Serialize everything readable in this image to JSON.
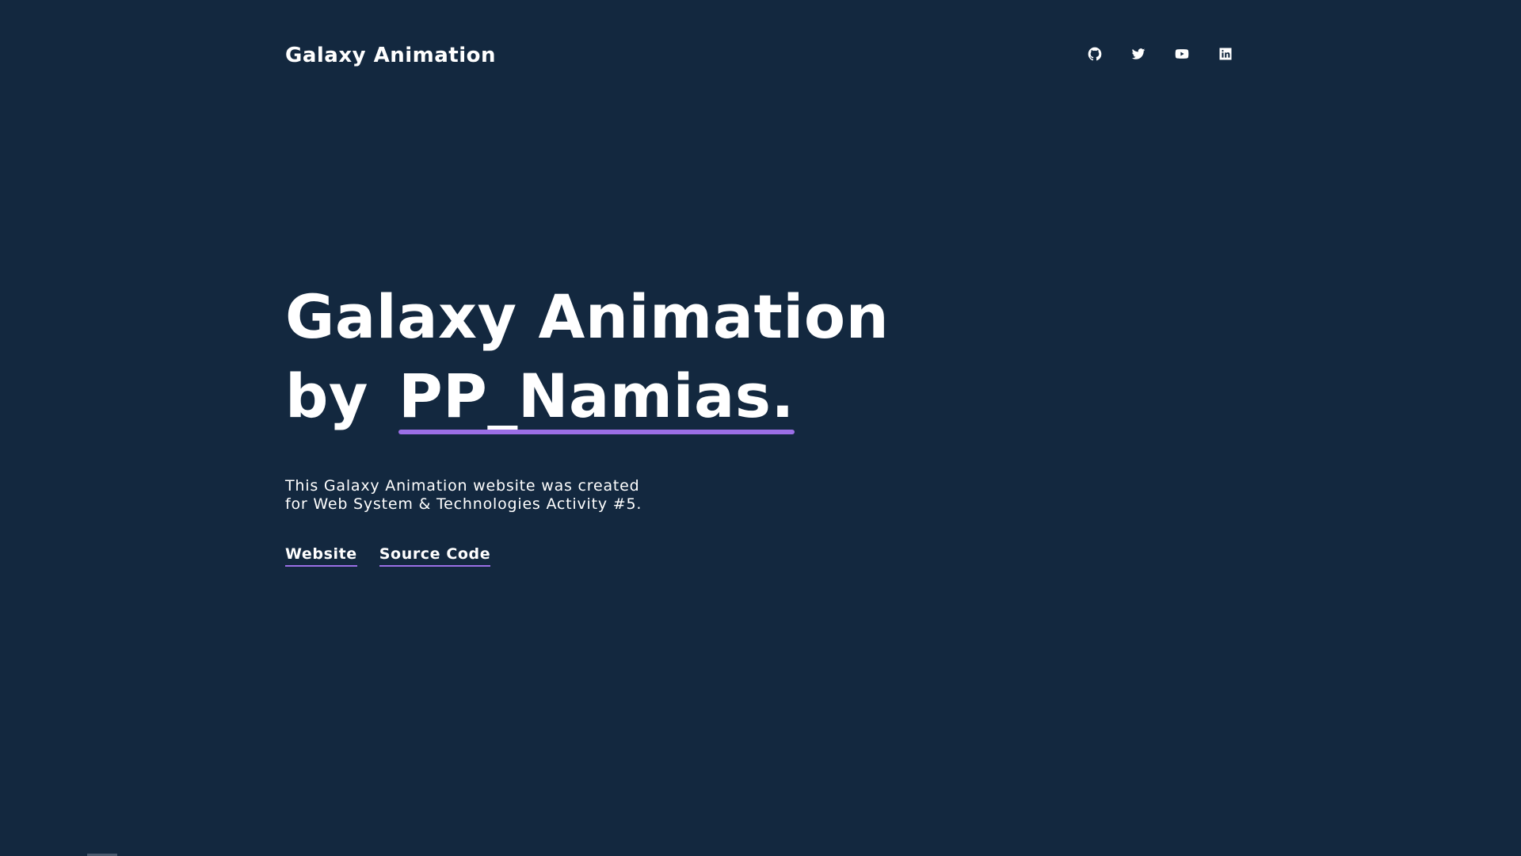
{
  "header": {
    "brand": "Galaxy Animation",
    "social": [
      {
        "icon": "github-icon"
      },
      {
        "icon": "twitter-icon"
      },
      {
        "icon": "youtube-icon"
      },
      {
        "icon": "linkedin-icon"
      }
    ]
  },
  "hero": {
    "title_line1": "Galaxy Animation",
    "title_by": "by",
    "author": "PP_Namias.",
    "description_line1": "This Galaxy Animation website was created",
    "description_line2": "for Web System & Technologies Activity #5.",
    "links": {
      "website": "Website",
      "source_code": "Source Code"
    }
  },
  "colors": {
    "background": "#13283f",
    "accent": "#9b6fe6",
    "text": "#ffffff"
  }
}
